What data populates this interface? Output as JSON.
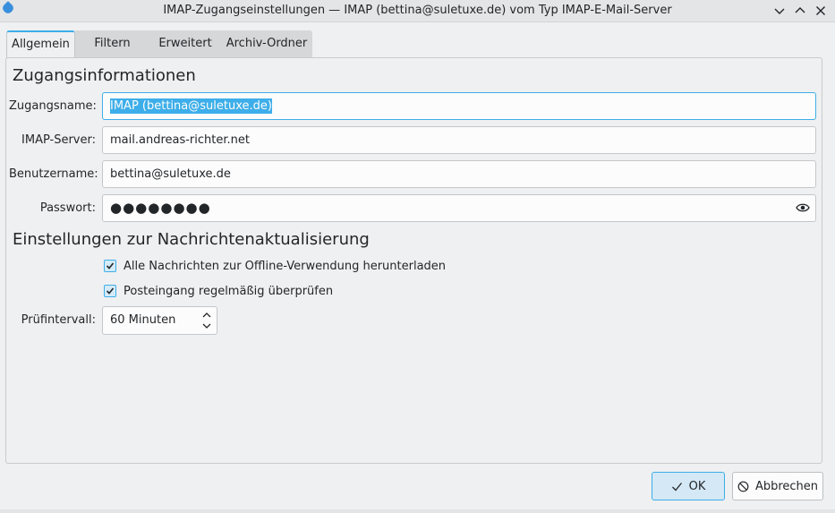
{
  "window": {
    "title": "IMAP-Zugangseinstellungen — IMAP (bettina@suletuxe.de) vom Typ IMAP-E-Mail-Server",
    "icons": [
      "app-icon",
      "chevron-down-icon",
      "chevron-up-icon",
      "close-icon"
    ]
  },
  "tabs": [
    {
      "label": "Allgemein",
      "active": true
    },
    {
      "label": "Filtern",
      "active": false
    },
    {
      "label": "Erweitert",
      "active": false
    },
    {
      "label": "Archiv-Ordner",
      "active": false
    }
  ],
  "account": {
    "heading": "Zugangsinformationen",
    "name_label": "Zugangsname:",
    "name_value": "IMAP (bettina@suletuxe.de)",
    "server_label": "IMAP-Server:",
    "server_value": "mail.andreas-richter.net",
    "user_label": "Benutzername:",
    "user_value": "bettina@suletuxe.de",
    "password_label": "Passwort:",
    "password_value": "●●●●●●●●"
  },
  "refresh": {
    "heading": "Einstellungen zur Nachrichtenaktualisierung",
    "offline_label": "Alle Nachrichten zur Offline-Verwendung herunterladen",
    "offline_checked": true,
    "poll_label": "Posteingang regelmäßig überprüfen",
    "poll_checked": true,
    "interval_label": "Prüfintervall:",
    "interval_value": "60 Minuten"
  },
  "buttons": {
    "ok_label": "OK",
    "cancel_label": "Abbrechen"
  },
  "colors": {
    "accent": "#3daee9",
    "window_bg": "#eff0f1"
  }
}
